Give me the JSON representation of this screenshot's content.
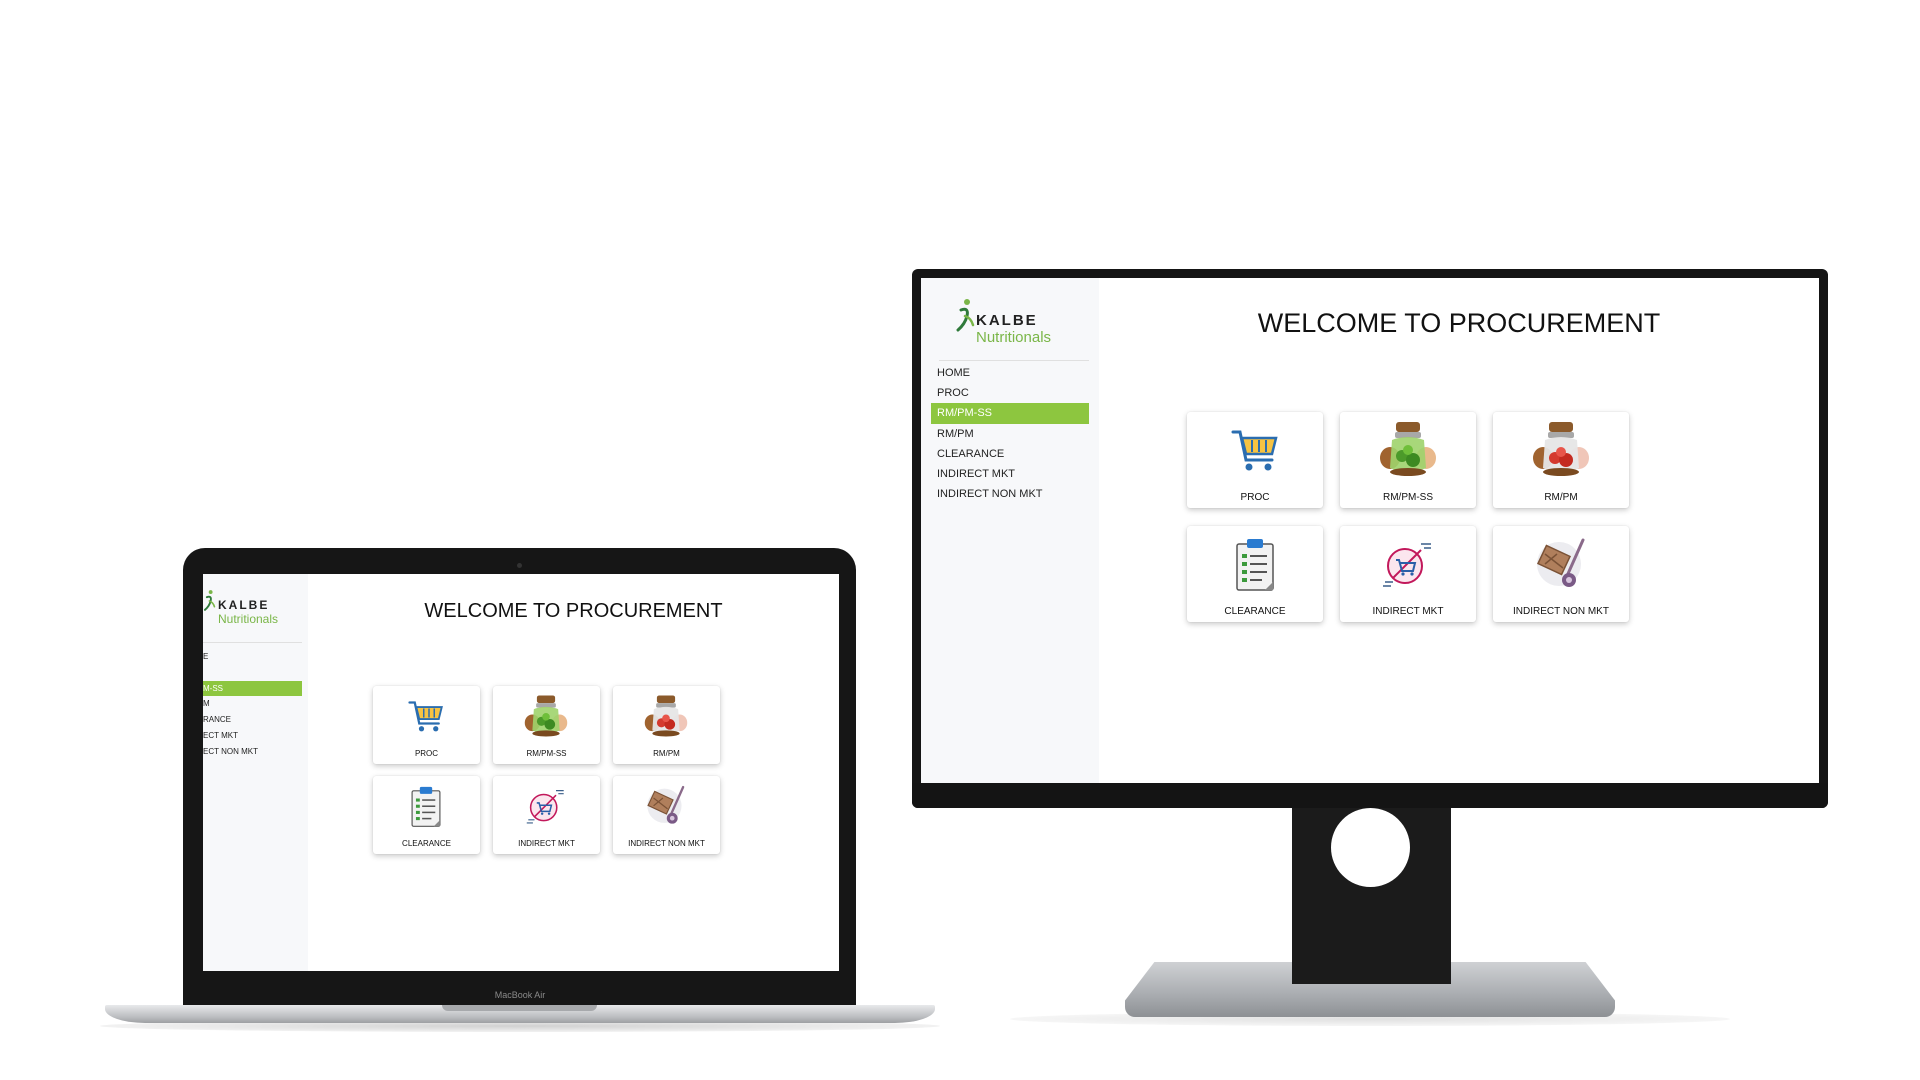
{
  "brand": {
    "name": "KALBE",
    "sub": "Nutritionals"
  },
  "page_title": "WELCOME TO PROCUREMENT",
  "nav": [
    {
      "label": "HOME"
    },
    {
      "label": "PROC"
    },
    {
      "label": "RM/PM-SS",
      "active": true
    },
    {
      "label": "RM/PM"
    },
    {
      "label": "CLEARANCE"
    },
    {
      "label": "INDIRECT MKT"
    },
    {
      "label": "INDIRECT NON MKT"
    }
  ],
  "cards": [
    {
      "label": "PROC",
      "icon": "shopping-cart-icon"
    },
    {
      "label": "RM/PM-SS",
      "icon": "green-jar-icon"
    },
    {
      "label": "RM/PM",
      "icon": "red-jar-icon"
    },
    {
      "label": "CLEARANCE",
      "icon": "clipboard-checklist-icon"
    },
    {
      "label": "INDIRECT MKT",
      "icon": "cart-badge-icon"
    },
    {
      "label": "INDIRECT NON MKT",
      "icon": "hand-truck-icon"
    }
  ],
  "laptop": {
    "brand_label": "MacBook Air",
    "nav_visible": [
      "E",
      "M-SS",
      "M",
      "RANCE",
      "ECT MKT",
      "ECT NON MKT"
    ]
  },
  "colors": {
    "accent": "#8dc63f",
    "logo_green": "#7ab648"
  }
}
